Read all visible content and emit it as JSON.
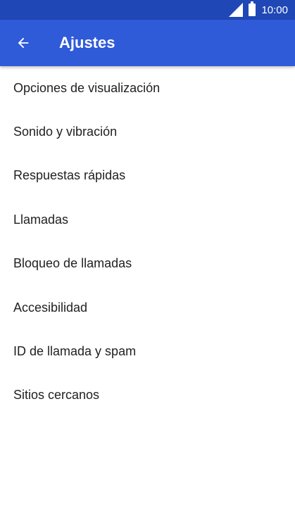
{
  "status_bar": {
    "time": "10:00",
    "icons": [
      "signal-icon",
      "battery-icon"
    ],
    "background": "#1f47b6"
  },
  "app_bar": {
    "title": "Ajustes",
    "back_icon": "arrow-left-icon",
    "background": "#2f5ad8"
  },
  "settings": {
    "items": [
      {
        "label": "Opciones de visualización"
      },
      {
        "label": "Sonido y vibración"
      },
      {
        "label": "Respuestas rápidas"
      },
      {
        "label": "Llamadas"
      },
      {
        "label": "Bloqueo de llamadas"
      },
      {
        "label": "Accesibilidad"
      },
      {
        "label": "ID de llamada y spam"
      },
      {
        "label": "Sitios cercanos"
      }
    ]
  }
}
